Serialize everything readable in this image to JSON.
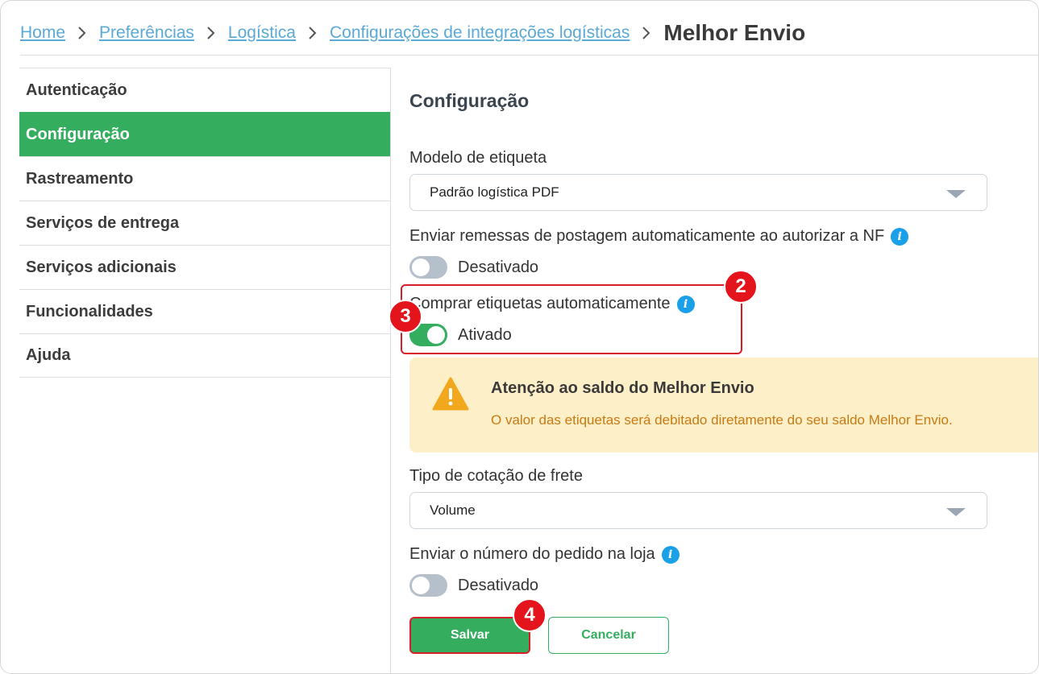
{
  "breadcrumb": {
    "items": [
      "Home",
      "Preferências",
      "Logística",
      "Configurações de integrações logísticas"
    ],
    "current": "Melhor Envio"
  },
  "sidebar": {
    "items": [
      {
        "label": "Autenticação"
      },
      {
        "label": "Configuração"
      },
      {
        "label": "Rastreamento"
      },
      {
        "label": "Serviços de entrega"
      },
      {
        "label": "Serviços adicionais"
      },
      {
        "label": "Funcionalidades"
      },
      {
        "label": "Ajuda"
      }
    ],
    "active_index": 1
  },
  "main": {
    "title": "Configuração",
    "label_template": {
      "label": "Modelo de etiqueta",
      "value": "Padrão logística PDF"
    },
    "auto_send": {
      "label": "Enviar remessas de postagem automaticamente ao autorizar a NF",
      "state": "Desativado",
      "on": false
    },
    "auto_buy": {
      "label": "Comprar etiquetas automaticamente",
      "state": "Ativado",
      "on": true
    },
    "alert": {
      "title": "Atenção ao saldo do Melhor Envio",
      "text": "O valor das etiquetas será debitado diretamente do seu saldo Melhor Envio."
    },
    "quote_type": {
      "label": "Tipo de cotação de frete",
      "value": "Volume"
    },
    "order_number": {
      "label": "Enviar o número do pedido na loja",
      "state": "Desativado",
      "on": false
    },
    "buttons": {
      "save": "Salvar",
      "cancel": "Cancelar"
    }
  },
  "info_glyph": "i",
  "step_badges": [
    "2",
    "3",
    "4"
  ],
  "colors": {
    "accent_green": "#34ae5e",
    "link_blue": "#5aa9d6",
    "info_blue": "#1aa0e8",
    "highlight_red": "#d81e28",
    "alert_bg": "#fdefc8",
    "alert_text": "#c77a12",
    "warning_orange": "#f2a81d"
  },
  "icons": [
    "chevron-right-icon",
    "info-icon",
    "caret-down-icon",
    "warning-triangle-icon"
  ]
}
